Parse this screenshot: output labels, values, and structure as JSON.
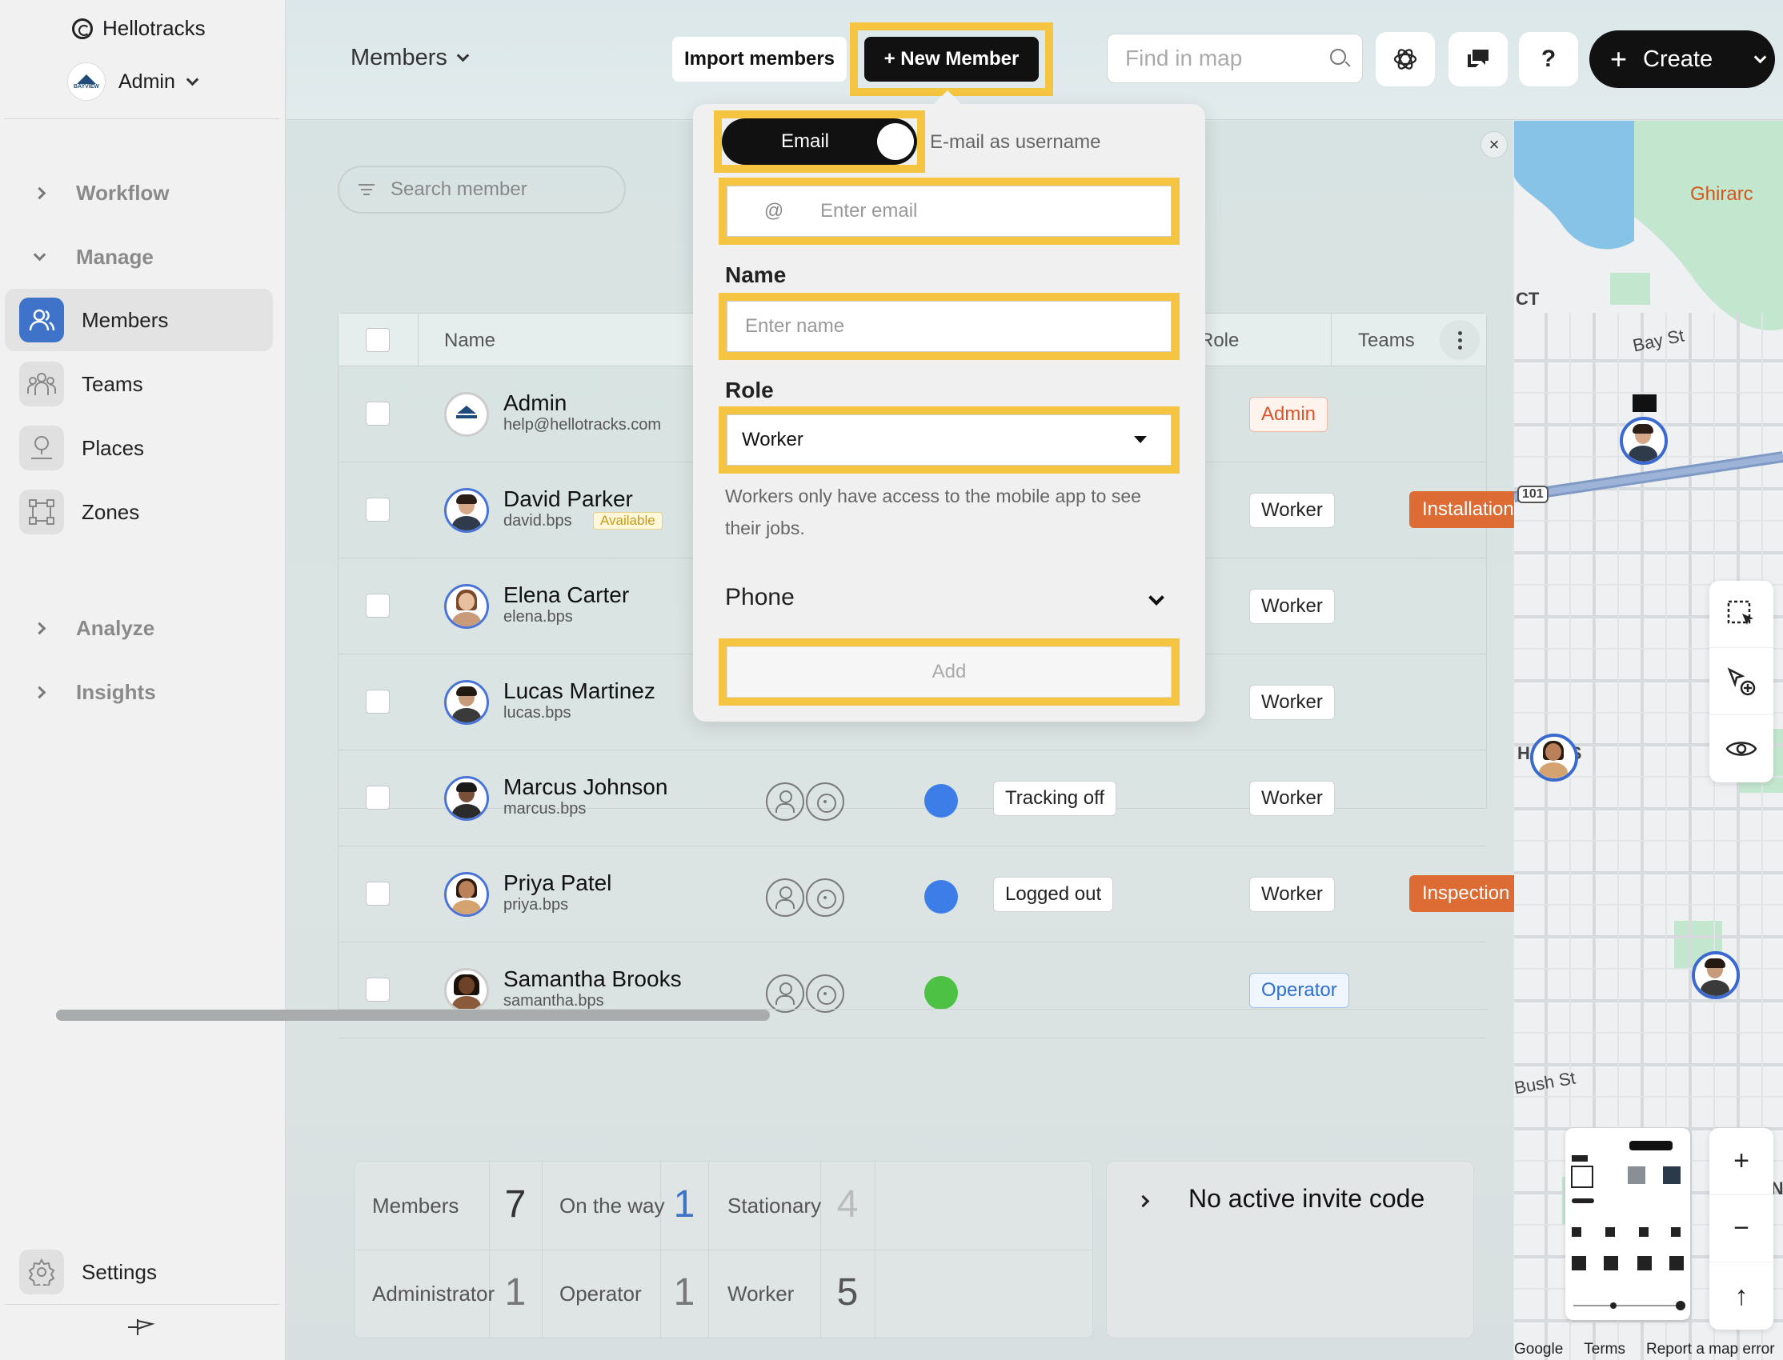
{
  "brand": {
    "name": "Hellotracks"
  },
  "account": {
    "name": "Admin",
    "logo_text": "BAYVIEW"
  },
  "sidebar": {
    "sections": {
      "workflow": "Workflow",
      "manage": "Manage",
      "analyze": "Analyze",
      "insights": "Insights"
    },
    "items": [
      {
        "label": "Members",
        "icon": "members-icon",
        "active": true
      },
      {
        "label": "Teams",
        "icon": "teams-icon"
      },
      {
        "label": "Places",
        "icon": "places-icon"
      },
      {
        "label": "Zones",
        "icon": "zones-icon"
      }
    ],
    "settings": "Settings"
  },
  "header": {
    "title": "Members",
    "import_label": "Import members",
    "new_member_label": "+ New Member",
    "find_placeholder": "Find in map",
    "help_label": "?",
    "create_label": "Create"
  },
  "list": {
    "search_placeholder": "Search member",
    "columns": {
      "name": "Name",
      "role": "Role",
      "teams": "Teams"
    },
    "rows": [
      {
        "name": "Admin",
        "username": "help@hellotracks.com",
        "role": "Admin"
      },
      {
        "name": "David Parker",
        "username": "david.bps",
        "badge": "Available",
        "role": "Worker",
        "team": "Installation"
      },
      {
        "name": "Elena Carter",
        "username": "elena.bps",
        "role": "Worker"
      },
      {
        "name": "Lucas Martinez",
        "username": "lucas.bps",
        "role": "Worker"
      },
      {
        "name": "Marcus Johnson",
        "username": "marcus.bps",
        "status": "Tracking off",
        "role": "Worker",
        "dot_color": "#3d7de8"
      },
      {
        "name": "Priya Patel",
        "username": "priya.bps",
        "status": "Logged out",
        "role": "Worker",
        "team": "Inspection",
        "dot_color": "#3d7de8"
      },
      {
        "name": "Samantha Brooks",
        "username": "samantha.bps",
        "role": "Operator",
        "dot_color": "#4cc143"
      }
    ]
  },
  "stats": {
    "members": {
      "label": "Members",
      "value": "7"
    },
    "on_the_way": {
      "label": "On the way",
      "value": "1"
    },
    "stationary": {
      "label": "Stationary",
      "value": "4"
    },
    "administrator": {
      "label": "Administrator",
      "value": "1"
    },
    "operator": {
      "label": "Operator",
      "value": "1"
    },
    "worker": {
      "label": "Worker",
      "value": "5"
    }
  },
  "invite": {
    "text": "No active invite code"
  },
  "new_member_form": {
    "toggle_label": "Email",
    "toggle_description": "E-mail as username",
    "email_prefix": "@",
    "email_placeholder": "Enter email",
    "name_label": "Name",
    "name_placeholder": "Enter name",
    "role_label": "Role",
    "role_value": "Worker",
    "role_help": "Workers only have access to the mobile app to see their jobs.",
    "phone_label": "Phone",
    "add_label": "Add"
  },
  "map": {
    "labels": {
      "ghirardelli": "Ghirarc",
      "ct": "CT",
      "bay_st": "Bay St",
      "hts": "H    TS",
      "bush_st": "Bush St",
      "wn": "WN",
      "route": "101"
    },
    "footer": {
      "google": "Google",
      "terms": "Terms",
      "report": "Report a map error"
    }
  },
  "colors": {
    "highlight": "#f5c542",
    "accent": "#3f73c9",
    "team": "#dd6b34"
  }
}
